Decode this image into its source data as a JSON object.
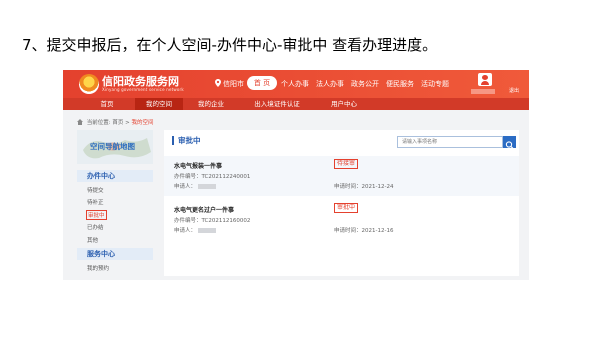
{
  "slide": {
    "title": "7、提交申报后，在个人空间-办件中心-审批中 查看办理进度。"
  },
  "header": {
    "site_name": "信阳政务服务网",
    "site_subtitle": "Xinyang government service network",
    "location": "信阳市",
    "home_button": "首 页",
    "top_links": [
      "个人办事",
      "法人办事",
      "政务公开",
      "便民服务",
      "活动专题"
    ],
    "logout": "退出",
    "brand_color": "#e4412e"
  },
  "nav": {
    "items": [
      "首页",
      "我的空间",
      "我的企业",
      "出入境证件认证",
      "用户中心"
    ],
    "active_index": 1
  },
  "breadcrumb": {
    "label": "当前位置:",
    "home": "首页",
    "sep": ">",
    "current": "我的空间"
  },
  "sidebar": {
    "map_label": "空间导航地图",
    "sections": [
      {
        "title": "办件中心",
        "items": [
          "待提交",
          "待补正",
          "审批中",
          "已办结",
          "其他"
        ]
      },
      {
        "title": "服务中心",
        "items": [
          "我的预约"
        ]
      }
    ],
    "active_item": "审批中"
  },
  "main": {
    "title": "审批中",
    "search_placeholder": "请输入事项名称",
    "items": [
      {
        "name": "水电气报装一件事",
        "number_label": "办件编号：",
        "number": "TC202112240001",
        "applicant_label": "申请人：",
        "status": "待接审",
        "time_label": "申请时间：",
        "time": "2021-12-24"
      },
      {
        "name": "水电气更名过户一件事",
        "number_label": "办件编号：",
        "number": "TC202112160002",
        "applicant_label": "申请人：",
        "status": "审批中",
        "time_label": "申请时间：",
        "time": "2021-12-16"
      }
    ]
  }
}
